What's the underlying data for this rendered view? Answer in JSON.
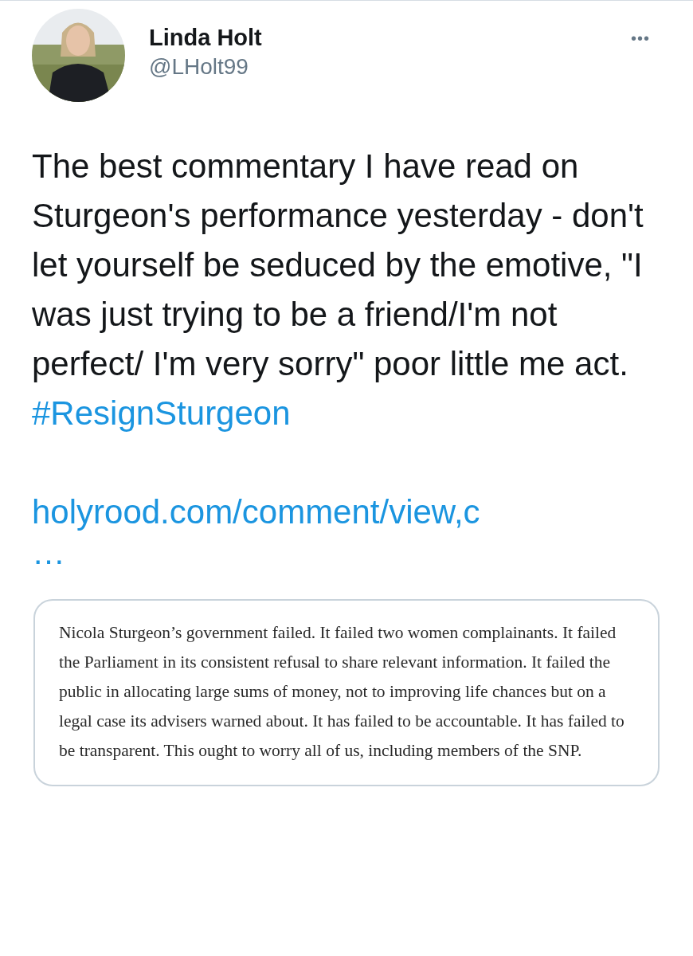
{
  "author": {
    "name": "Linda Holt",
    "handle": "@LHolt99"
  },
  "more_menu": {
    "label": "•••"
  },
  "tweet": {
    "text": "The best commentary I have read on Sturgeon's performance yesterday - don't let yourself be seduced by the emotive, \"I was just trying to be a friend/I'm not perfect/ I'm very sorry\" poor little me act.",
    "hashtag": "#ResignSturgeon"
  },
  "link": {
    "text": "holyrood.com/comment/view,c",
    "ellipsis": "…"
  },
  "quote_card": {
    "text": "Nicola Sturgeon’s government failed.  It failed two women complainants.  It failed the Parliament in its consistent refusal to share relevant information.  It failed the public in allocating large sums of money, not to improving life chances but on a legal case its advisers warned about.  It has failed to be accountable.  It has failed to be transparent.  This ought to worry all of us, including members of the SNP."
  }
}
